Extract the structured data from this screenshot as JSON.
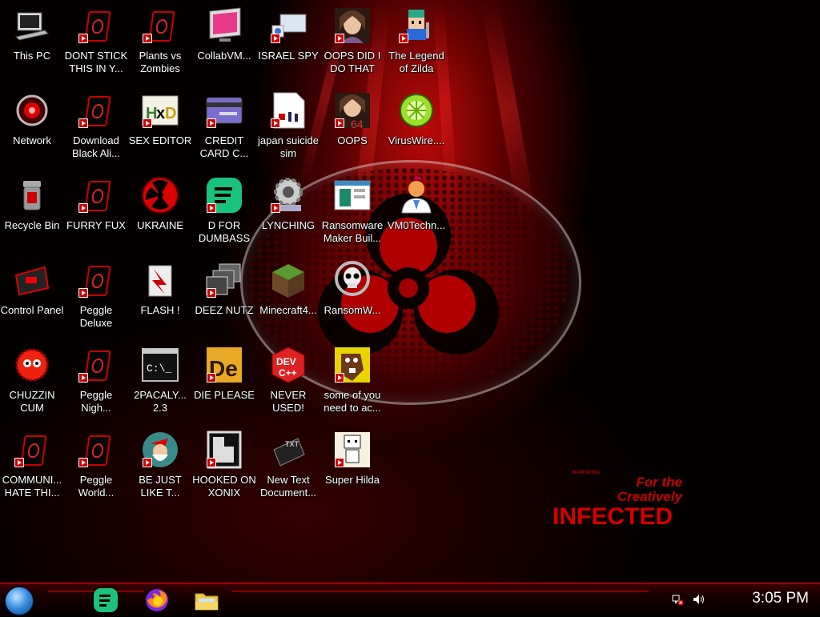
{
  "wallpaper": {
    "brand_small": "WARNING",
    "brand_line1": "For the",
    "brand_line2": "Creatively",
    "brand_big": "INFECTED"
  },
  "desktop": {
    "icons": [
      {
        "label": "This PC",
        "icon": "computer-icon"
      },
      {
        "label": "Network",
        "icon": "network-icon"
      },
      {
        "label": "Recycle Bin",
        "icon": "recycle-bin-icon"
      },
      {
        "label": "Control Panel",
        "icon": "control-panel-icon"
      },
      {
        "label": "CHUZZIN CUM",
        "icon": "chuzzle-icon"
      },
      {
        "label": "COMMUNI... HATE THI...",
        "icon": "alien-shortcut-icon"
      },
      {
        "label": "DONT STICK THIS IN Y...",
        "icon": "alien-shortcut-icon"
      },
      {
        "label": "Download Black Ali...",
        "icon": "alien-shortcut-icon"
      },
      {
        "label": "FURRY FUX",
        "icon": "alien-shortcut-icon"
      },
      {
        "label": "Peggle Deluxe",
        "icon": "alien-shortcut-icon"
      },
      {
        "label": "Peggle Nigh...",
        "icon": "alien-shortcut-icon"
      },
      {
        "label": "Peggle World...",
        "icon": "alien-shortcut-icon"
      },
      {
        "label": "Plants vs Zombies",
        "icon": "alien-shortcut-icon"
      },
      {
        "label": "SEX EDITOR",
        "icon": "hxd-editor-icon"
      },
      {
        "label": "UKRAINE",
        "icon": "radiation-icon"
      },
      {
        "label": "FLASH !",
        "icon": "flash-icon"
      },
      {
        "label": "2PACALY... 2.3",
        "icon": "console-icon"
      },
      {
        "label": "BE JUST LIKE T...",
        "icon": "santa-icon"
      },
      {
        "label": "CollabVM...",
        "icon": "monitor-icon"
      },
      {
        "label": "CREDIT CARD C...",
        "icon": "credit-card-icon"
      },
      {
        "label": "D FOR DUMBASS",
        "icon": "chat-icon"
      },
      {
        "label": "DEEZ NUTZ",
        "icon": "windows-stack-icon"
      },
      {
        "label": "DIE PLEASE",
        "icon": "die-icon"
      },
      {
        "label": "HOOKED ON XONIX",
        "icon": "xonix-icon"
      },
      {
        "label": "ISRAEL SPY",
        "icon": "spy-window-icon"
      },
      {
        "label": "japan suicide sim",
        "icon": "document-icon"
      },
      {
        "label": "LYNCHING",
        "icon": "gear-icon"
      },
      {
        "label": "Minecraft4...",
        "icon": "grass-block-icon"
      },
      {
        "label": "NEVER USED!",
        "icon": "dev-cpp-icon"
      },
      {
        "label": "New Text Document...",
        "icon": "text-file-icon"
      },
      {
        "label": "OOPS DID I DO THAT",
        "icon": "portrait-icon"
      },
      {
        "label": "OOPS",
        "icon": "portrait-64-icon"
      },
      {
        "label": "Ransomware Maker Buil...",
        "icon": "window-icon"
      },
      {
        "label": "RansomW...",
        "icon": "skull-icon"
      },
      {
        "label": "some of you need to ac...",
        "icon": "beaver-icon"
      },
      {
        "label": "Super Hilda",
        "icon": "pixel-art-icon"
      },
      {
        "label": "The Legend of Zilda",
        "icon": "pixel-hero-icon"
      },
      {
        "label": "VirusWire....",
        "icon": "limewire-icon"
      },
      {
        "label": "VM0Techn...",
        "icon": "doctor-icon"
      }
    ]
  },
  "taskbar": {
    "pinned": [
      {
        "icon": "green-chat-app-icon"
      },
      {
        "icon": "firefox-icon"
      },
      {
        "icon": "file-explorer-icon"
      }
    ],
    "clock": "3:05 PM",
    "colors": {
      "accent": "#a00000",
      "start_orb": "#3a8fe0"
    }
  }
}
